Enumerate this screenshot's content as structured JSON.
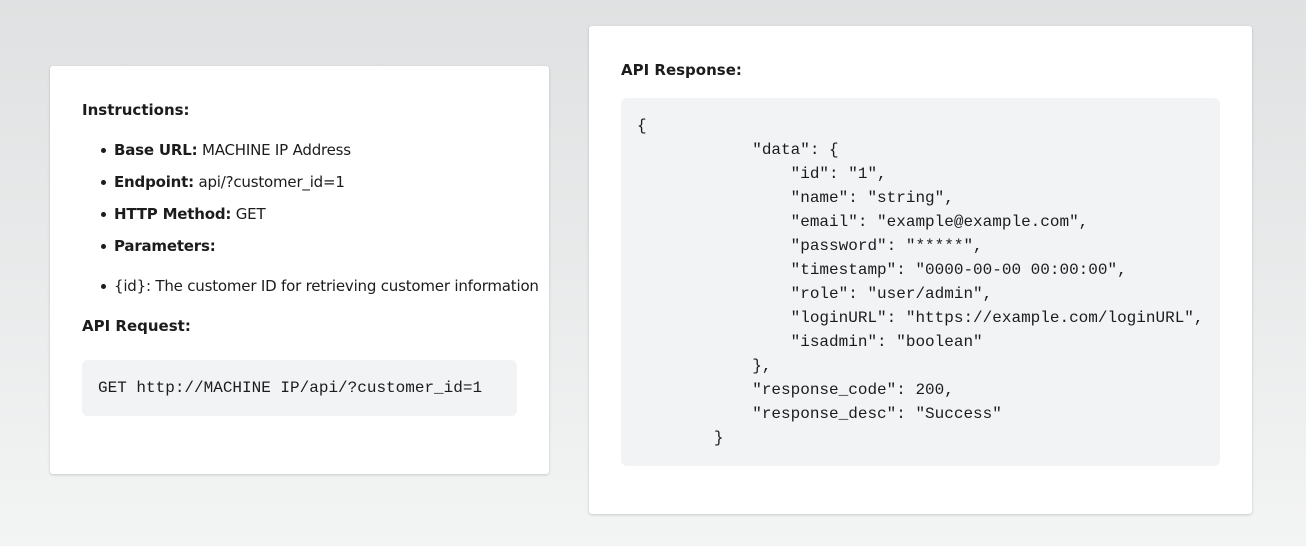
{
  "instructions": {
    "heading": "Instructions:",
    "items": [
      {
        "key": "Base URL:",
        "value": "MACHINE IP Address"
      },
      {
        "key": "Endpoint:",
        "value": "api/?customer_id=1"
      },
      {
        "key": "HTTP Method:",
        "value": "GET"
      },
      {
        "key": "Parameters:",
        "value": ""
      }
    ],
    "parameters": [
      {
        "text": "{id}: The customer ID for retrieving customer information"
      }
    ]
  },
  "request": {
    "heading": "API Request:",
    "code": "GET http://MACHINE IP/api/?customer_id=1"
  },
  "response": {
    "heading": "API Response:",
    "code": "{\n            \"data\": {\n                \"id\": \"1\",\n                \"name\": \"string\",\n                \"email\": \"example@example.com\",\n                \"password\": \"*****\",\n                \"timestamp\": \"0000-00-00 00:00:00\",\n                \"role\": \"user/admin\",\n                \"loginURL\": \"https://example.com/loginURL\",\n                \"isadmin\": \"boolean\"\n            },\n            \"response_code\": 200,\n            \"response_desc\": \"Success\"\n        }"
  }
}
